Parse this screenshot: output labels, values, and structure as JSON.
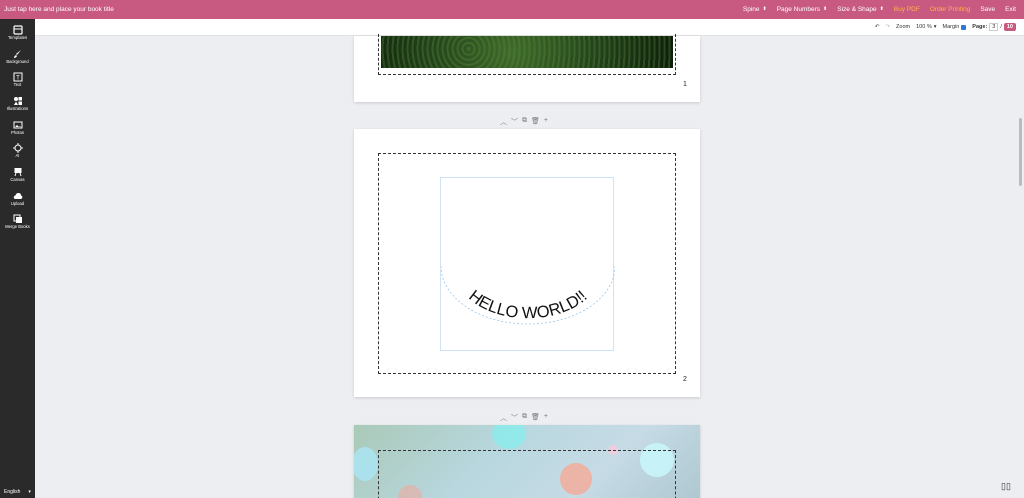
{
  "topbar": {
    "title": "Just tap here and place your book title",
    "spine": "Spine",
    "page_numbers": "Page Numbers",
    "size_shape": "Size & Shape",
    "buy_pdf": "Buy PDF",
    "order_printing": "Order Printing",
    "save": "Save",
    "exit": "Exit",
    "bg_color": "#c85a82",
    "accent": "#ffb347"
  },
  "sidebar": {
    "items": [
      {
        "label": "Templates",
        "icon": "templates-icon"
      },
      {
        "label": "Background",
        "icon": "brush-icon"
      },
      {
        "label": "Text",
        "icon": "text-icon"
      },
      {
        "label": "Illustrations",
        "icon": "shapes-icon"
      },
      {
        "label": "Photos",
        "icon": "image-icon"
      },
      {
        "label": "AI",
        "icon": "ai-icon"
      },
      {
        "label": "Canvas",
        "icon": "canvas-icon"
      },
      {
        "label": "Upload",
        "icon": "upload-icon"
      },
      {
        "label": "Merge Books",
        "icon": "merge-icon"
      }
    ],
    "language": "English"
  },
  "toolbar": {
    "zoom_label": "Zoom",
    "zoom_value": "100 %",
    "margin_label": "Margin",
    "page_label": "Page:",
    "page_current": "3",
    "page_separator": "/",
    "page_total": "10"
  },
  "pages": {
    "page1_number": "1",
    "page2_number": "2",
    "page2_text": "HELLO WORLD!!"
  }
}
